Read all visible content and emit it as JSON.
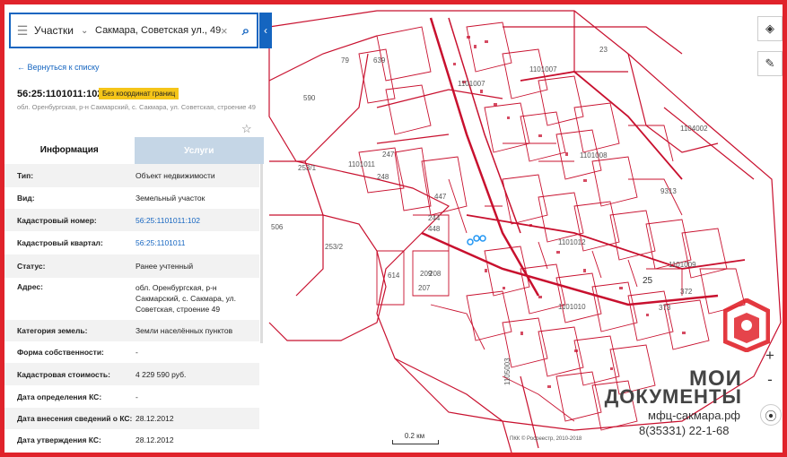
{
  "search": {
    "type_label": "Участки",
    "query": "Сакмара, Советская ул., 49"
  },
  "panel": {
    "back_link": "← Вернуться к списку",
    "cad_number": "56:25:1101011:102",
    "badge": "Без координат границ",
    "address_short": "обл. Оренбургская, р-н Сакмарский, с. Сакмара, ул. Советская, строение 49",
    "tabs": [
      {
        "label": "Информация"
      },
      {
        "label": "Услуги"
      }
    ],
    "rows": [
      {
        "label": "Тип:",
        "value": "Объект недвижимости"
      },
      {
        "label": "Вид:",
        "value": "Земельный участок"
      },
      {
        "label": "Кадастровый номер:",
        "value": "56:25:1101011:102"
      },
      {
        "label": "Кадастровый квартал:",
        "value": "56:25:1101011"
      },
      {
        "label": "Статус:",
        "value": "Ранее учтенный"
      },
      {
        "label": "Адрес:",
        "value": "обл. Оренбургская, р-н Сакмарский, с. Сакмара, ул. Советская, строение 49"
      },
      {
        "label": "Категория земель:",
        "value": "Земли населённых пунктов"
      },
      {
        "label": "Форма собственности:",
        "value": "-"
      },
      {
        "label": "Кадастровая стоимость:",
        "value": "4 229 590 руб."
      },
      {
        "label": "Дата определения КС:",
        "value": "-"
      },
      {
        "label": "Дата внесения сведений о КС:",
        "value": "28.12.2012"
      },
      {
        "label": "Дата утверждения КС:",
        "value": "28.12.2012"
      }
    ]
  },
  "map": {
    "parcel_labels": [
      "23",
      "1104002",
      "1101007",
      "1101007",
      "1101008",
      "1101011",
      "1101012",
      "1101009",
      "1105003",
      "1101010",
      "590",
      "253/1",
      "253/2",
      "506",
      "639",
      "79",
      "247",
      "248",
      "244",
      "448",
      "447",
      "614",
      "209",
      "208",
      "207",
      "372",
      "373",
      "9313",
      "25"
    ],
    "scale_label": "0.2 км",
    "attribution": "ПКК © Росреестр, 2010-2018"
  },
  "logo": {
    "line1": "МОИ",
    "line2": "ДОКУМЕНТЫ",
    "site": "мфц-сакмара.рф",
    "phone": "8(35331) 22-1-68"
  },
  "toolbar": {
    "layers_icon": "layers-icon",
    "ruler_icon": "ruler-icon",
    "zoom_in": "+",
    "zoom_out": "-",
    "locate_icon": "compass-icon"
  },
  "colors": {
    "frame": "#e0232b",
    "map_lines": "#c8102e",
    "accent": "#1565c0",
    "badge": "#f5c518"
  }
}
